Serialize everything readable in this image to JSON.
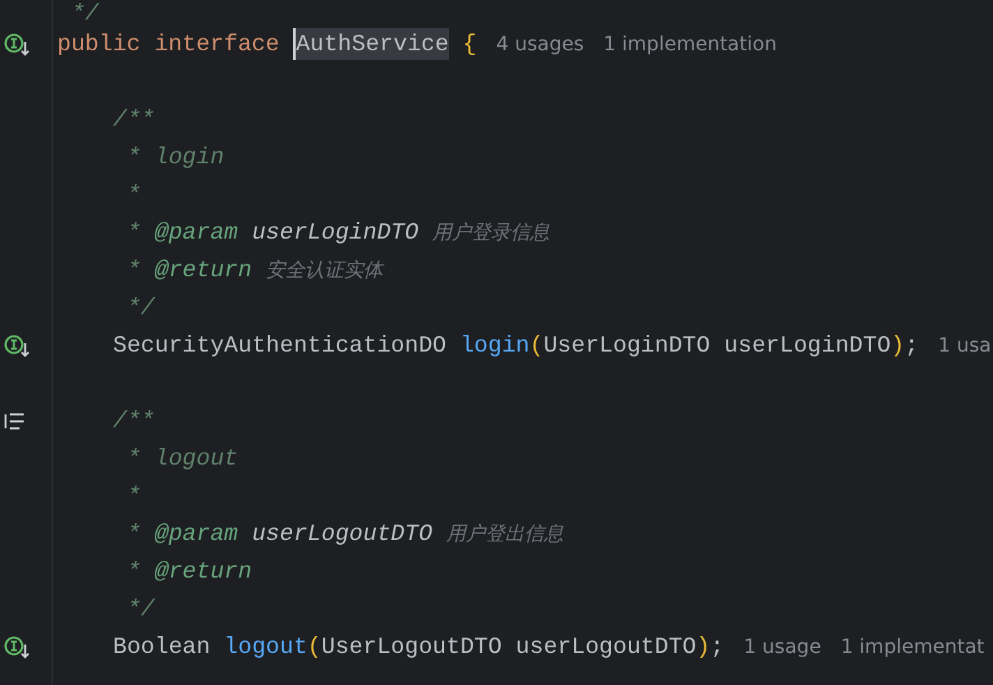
{
  "cut_line": {
    "tokens": [
      {
        "kind": "comment",
        "text": " */"
      }
    ]
  },
  "lines": [
    {
      "gutter": {
        "kind": "implemented"
      },
      "tokens": [
        {
          "kind": "keyword",
          "text": "public interface "
        },
        {
          "kind": "selection",
          "text": "AuthService"
        },
        {
          "kind": "brace",
          "text": " {"
        },
        {
          "kind": "hint",
          "text": "4 usages"
        },
        {
          "kind": "hint",
          "text": "1 implementation"
        }
      ],
      "members": [
        {
          "lines": [
            {
              "tokens": [
                {
                  "kind": "comment",
                  "text": "/**"
                }
              ]
            },
            {
              "tokens": [
                {
                  "kind": "comment",
                  "text": " * login"
                }
              ]
            },
            {
              "tokens": [
                {
                  "kind": "comment",
                  "text": " *"
                }
              ]
            },
            {
              "tokens": [
                {
                  "kind": "comment",
                  "text": " * "
                },
                {
                  "kind": "doctag",
                  "text": "@param "
                },
                {
                  "kind": "docparam",
                  "text": "userLoginDTO"
                },
                {
                  "kind": "doctext",
                  "text": "用户登录信息"
                }
              ]
            },
            {
              "tokens": [
                {
                  "kind": "comment",
                  "text": " * "
                },
                {
                  "kind": "doctag",
                  "text": "@return"
                },
                {
                  "kind": "doctext",
                  "text": "安全认证实体"
                }
              ]
            },
            {
              "tokens": [
                {
                  "kind": "comment",
                  "text": " */"
                }
              ]
            },
            {
              "gutter": {
                "kind": "implemented"
              },
              "tokens": [
                {
                  "kind": "plain",
                  "text": "SecurityAuthenticationDO "
                },
                {
                  "kind": "method",
                  "text": "login"
                },
                {
                  "kind": "paren",
                  "text": "("
                },
                {
                  "kind": "plain",
                  "text": "UserLoginDTO userLoginDTO"
                },
                {
                  "kind": "paren",
                  "text": ")"
                },
                {
                  "kind": "plain",
                  "text": ";"
                },
                {
                  "kind": "hint",
                  "text": "1 usa"
                }
              ]
            }
          ]
        },
        {
          "lines": [
            {
              "gutter": {
                "kind": "doc"
              },
              "tokens": [
                {
                  "kind": "comment",
                  "text": "/**"
                }
              ]
            },
            {
              "tokens": [
                {
                  "kind": "comment",
                  "text": " * logout"
                }
              ]
            },
            {
              "tokens": [
                {
                  "kind": "comment",
                  "text": " *"
                }
              ]
            },
            {
              "tokens": [
                {
                  "kind": "comment",
                  "text": " * "
                },
                {
                  "kind": "doctag",
                  "text": "@param "
                },
                {
                  "kind": "docparam",
                  "text": "userLogoutDTO"
                },
                {
                  "kind": "doctext",
                  "text": "用户登出信息"
                }
              ]
            },
            {
              "tokens": [
                {
                  "kind": "comment",
                  "text": " * "
                },
                {
                  "kind": "doctag",
                  "text": "@return"
                }
              ]
            },
            {
              "tokens": [
                {
                  "kind": "comment",
                  "text": " */"
                }
              ]
            },
            {
              "gutter": {
                "kind": "implemented"
              },
              "tokens": [
                {
                  "kind": "plain",
                  "text": "Boolean "
                },
                {
                  "kind": "method",
                  "text": "logout"
                },
                {
                  "kind": "paren",
                  "text": "("
                },
                {
                  "kind": "plain",
                  "text": "UserLogoutDTO userLogoutDTO"
                },
                {
                  "kind": "paren",
                  "text": ")"
                },
                {
                  "kind": "plain",
                  "text": ";"
                },
                {
                  "kind": "hint",
                  "text": "1 usage"
                },
                {
                  "kind": "hint",
                  "text": "1 implementat"
                }
              ]
            }
          ]
        }
      ]
    }
  ]
}
